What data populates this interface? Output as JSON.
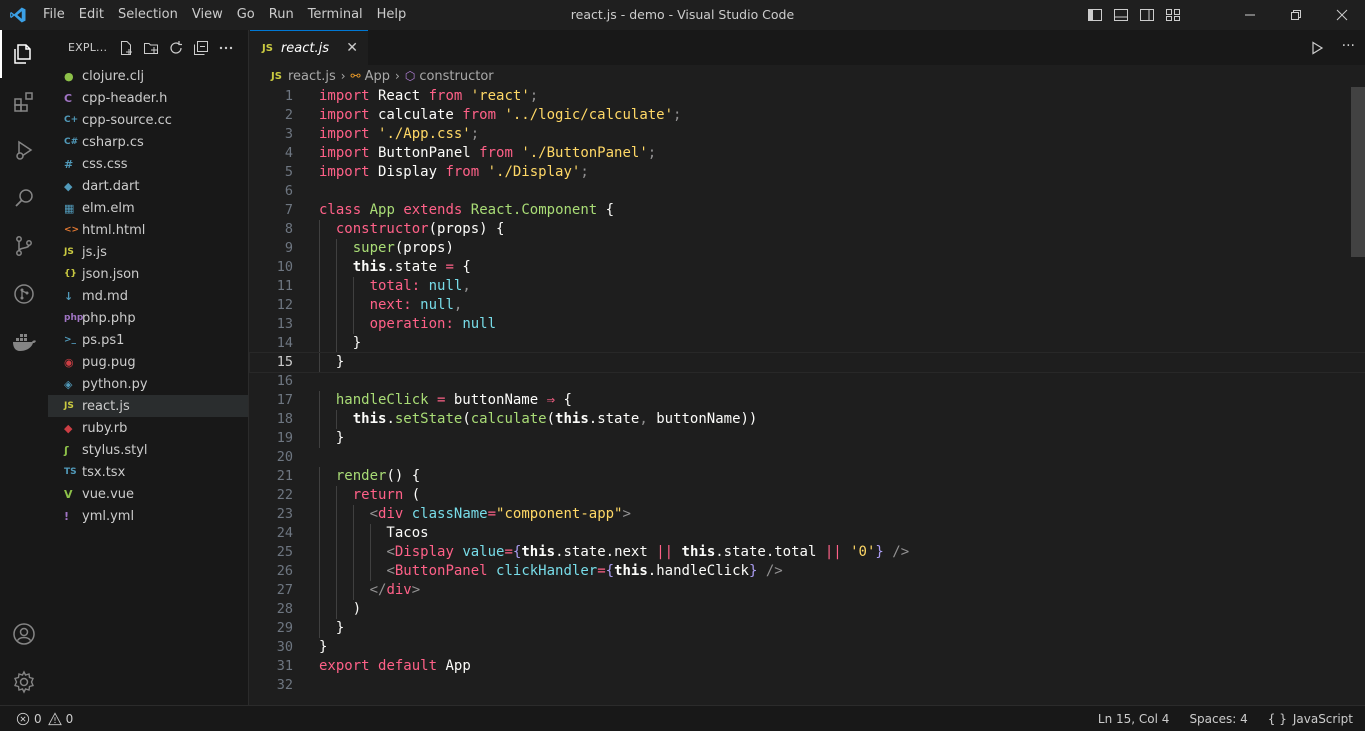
{
  "titlebar": {
    "title": "react.js - demo - Visual Studio Code",
    "menu": [
      "File",
      "Edit",
      "Selection",
      "View",
      "Go",
      "Run",
      "Terminal",
      "Help"
    ]
  },
  "sidebar": {
    "title": "EXPL...",
    "files": [
      {
        "name": "clojure.clj",
        "icon": "clojure-icon",
        "glyph": "●",
        "color": "#8dc149"
      },
      {
        "name": "cpp-header.h",
        "icon": "c-icon",
        "glyph": "C",
        "color": "#a074c4"
      },
      {
        "name": "cpp-source.cc",
        "icon": "cpp-icon",
        "glyph": "C+",
        "color": "#519aba"
      },
      {
        "name": "csharp.cs",
        "icon": "csharp-icon",
        "glyph": "C#",
        "color": "#519aba"
      },
      {
        "name": "css.css",
        "icon": "css-icon",
        "glyph": "#",
        "color": "#519aba"
      },
      {
        "name": "dart.dart",
        "icon": "dart-icon",
        "glyph": "◆",
        "color": "#519aba"
      },
      {
        "name": "elm.elm",
        "icon": "elm-icon",
        "glyph": "▦",
        "color": "#519aba"
      },
      {
        "name": "html.html",
        "icon": "html-icon",
        "glyph": "<>",
        "color": "#e37933"
      },
      {
        "name": "js.js",
        "icon": "js-icon",
        "glyph": "JS",
        "color": "#cbcb41"
      },
      {
        "name": "json.json",
        "icon": "json-icon",
        "glyph": "{}",
        "color": "#cbcb41"
      },
      {
        "name": "md.md",
        "icon": "markdown-icon",
        "glyph": "↓",
        "color": "#519aba"
      },
      {
        "name": "php.php",
        "icon": "php-icon",
        "glyph": "php",
        "color": "#a074c4"
      },
      {
        "name": "ps.ps1",
        "icon": "powershell-icon",
        "glyph": ">_",
        "color": "#519aba"
      },
      {
        "name": "pug.pug",
        "icon": "pug-icon",
        "glyph": "◉",
        "color": "#cc3e44"
      },
      {
        "name": "python.py",
        "icon": "python-icon",
        "glyph": "◈",
        "color": "#519aba"
      },
      {
        "name": "react.js",
        "icon": "js-icon",
        "glyph": "JS",
        "color": "#cbcb41",
        "selected": true
      },
      {
        "name": "ruby.rb",
        "icon": "ruby-icon",
        "glyph": "◆",
        "color": "#cc3e44"
      },
      {
        "name": "stylus.styl",
        "icon": "stylus-icon",
        "glyph": "ʃ",
        "color": "#8dc149"
      },
      {
        "name": "tsx.tsx",
        "icon": "typescript-icon",
        "glyph": "TS",
        "color": "#519aba"
      },
      {
        "name": "vue.vue",
        "icon": "vue-icon",
        "glyph": "V",
        "color": "#8dc149"
      },
      {
        "name": "yml.yml",
        "icon": "yaml-icon",
        "glyph": "!",
        "color": "#a074c4"
      }
    ]
  },
  "editor": {
    "tab_label": "react.js",
    "tab_badge": "JS",
    "breadcrumb": [
      "react.js",
      "App",
      "constructor"
    ],
    "current_line": 15,
    "lines": [
      [
        [
          "kw",
          "import"
        ],
        [
          "var",
          " React "
        ],
        [
          "kw",
          "from"
        ],
        [
          "punc",
          " "
        ],
        [
          "str",
          "'react'"
        ],
        [
          "punc",
          ";"
        ]
      ],
      [
        [
          "kw",
          "import"
        ],
        [
          "var",
          " calculate "
        ],
        [
          "kw",
          "from"
        ],
        [
          "punc",
          " "
        ],
        [
          "str",
          "'../logic/calculate'"
        ],
        [
          "punc",
          ";"
        ]
      ],
      [
        [
          "kw",
          "import"
        ],
        [
          "punc",
          " "
        ],
        [
          "str",
          "'./App.css'"
        ],
        [
          "punc",
          ";"
        ]
      ],
      [
        [
          "kw",
          "import"
        ],
        [
          "var",
          " ButtonPanel "
        ],
        [
          "kw",
          "from"
        ],
        [
          "punc",
          " "
        ],
        [
          "str",
          "'./ButtonPanel'"
        ],
        [
          "punc",
          ";"
        ]
      ],
      [
        [
          "kw",
          "import"
        ],
        [
          "var",
          " Display "
        ],
        [
          "kw",
          "from"
        ],
        [
          "punc",
          " "
        ],
        [
          "str",
          "'./Display'"
        ],
        [
          "punc",
          ";"
        ]
      ],
      [],
      [
        [
          "kw",
          "class"
        ],
        [
          "var",
          " "
        ],
        [
          "cls",
          "App"
        ],
        [
          "var",
          " "
        ],
        [
          "kw",
          "extends"
        ],
        [
          "var",
          " "
        ],
        [
          "cls",
          "React.Component"
        ],
        [
          "var",
          " {"
        ]
      ],
      [
        [
          "var",
          "  "
        ],
        [
          "kw",
          "constructor"
        ],
        [
          "var",
          "(props) {"
        ]
      ],
      [
        [
          "var",
          "    "
        ],
        [
          "fn",
          "super"
        ],
        [
          "var",
          "(props)"
        ]
      ],
      [
        [
          "var",
          "    "
        ],
        [
          "ths",
          "this"
        ],
        [
          "var",
          ".state "
        ],
        [
          "op",
          "="
        ],
        [
          "var",
          " {"
        ]
      ],
      [
        [
          "var",
          "      "
        ],
        [
          "prop",
          "total"
        ],
        [
          "op",
          ":"
        ],
        [
          "var",
          " "
        ],
        [
          "cst",
          "null"
        ],
        [
          "punc",
          ","
        ]
      ],
      [
        [
          "var",
          "      "
        ],
        [
          "prop",
          "next"
        ],
        [
          "op",
          ":"
        ],
        [
          "var",
          " "
        ],
        [
          "cst",
          "null"
        ],
        [
          "punc",
          ","
        ]
      ],
      [
        [
          "var",
          "      "
        ],
        [
          "prop",
          "operation"
        ],
        [
          "op",
          ":"
        ],
        [
          "var",
          " "
        ],
        [
          "cst",
          "null"
        ]
      ],
      [
        [
          "var",
          "    }"
        ]
      ],
      [
        [
          "var",
          "  }"
        ]
      ],
      [],
      [
        [
          "var",
          "  "
        ],
        [
          "fn",
          "handleClick"
        ],
        [
          "var",
          " "
        ],
        [
          "op",
          "="
        ],
        [
          "var",
          " buttonName "
        ],
        [
          "op",
          "⇒"
        ],
        [
          "var",
          " {"
        ]
      ],
      [
        [
          "var",
          "    "
        ],
        [
          "ths",
          "this"
        ],
        [
          "var",
          "."
        ],
        [
          "fn",
          "setState"
        ],
        [
          "var",
          "("
        ],
        [
          "fn",
          "calculate"
        ],
        [
          "var",
          "("
        ],
        [
          "ths",
          "this"
        ],
        [
          "var",
          ".state"
        ],
        [
          "punc",
          ","
        ],
        [
          "var",
          " buttonName))"
        ]
      ],
      [
        [
          "var",
          "  }"
        ]
      ],
      [],
      [
        [
          "var",
          "  "
        ],
        [
          "fn",
          "render"
        ],
        [
          "var",
          "() {"
        ]
      ],
      [
        [
          "var",
          "    "
        ],
        [
          "kw",
          "return"
        ],
        [
          "var",
          " ("
        ]
      ],
      [
        [
          "var",
          "      "
        ],
        [
          "punc",
          "<"
        ],
        [
          "tag",
          "div"
        ],
        [
          "var",
          " "
        ],
        [
          "attr",
          "className"
        ],
        [
          "op",
          "="
        ],
        [
          "str",
          "\"component-app\""
        ],
        [
          "punc",
          ">"
        ]
      ],
      [
        [
          "var",
          "        Tacos"
        ]
      ],
      [
        [
          "var",
          "        "
        ],
        [
          "punc",
          "<"
        ],
        [
          "tag",
          "Display"
        ],
        [
          "var",
          " "
        ],
        [
          "attr",
          "value"
        ],
        [
          "op",
          "="
        ],
        [
          "mb",
          "{"
        ],
        [
          "ths",
          "this"
        ],
        [
          "var",
          ".state.next "
        ],
        [
          "op",
          "||"
        ],
        [
          "var",
          " "
        ],
        [
          "ths",
          "this"
        ],
        [
          "var",
          ".state.total "
        ],
        [
          "op",
          "||"
        ],
        [
          "var",
          " "
        ],
        [
          "str",
          "'0'"
        ],
        [
          "mb",
          "}"
        ],
        [
          "var",
          " "
        ],
        [
          "punc",
          "/>"
        ]
      ],
      [
        [
          "var",
          "        "
        ],
        [
          "punc",
          "<"
        ],
        [
          "tag",
          "ButtonPanel"
        ],
        [
          "var",
          " "
        ],
        [
          "attr",
          "clickHandler"
        ],
        [
          "op",
          "="
        ],
        [
          "mb",
          "{"
        ],
        [
          "ths",
          "this"
        ],
        [
          "var",
          ".handleClick"
        ],
        [
          "mb",
          "}"
        ],
        [
          "var",
          " "
        ],
        [
          "punc",
          "/>"
        ]
      ],
      [
        [
          "var",
          "      "
        ],
        [
          "punc",
          "</"
        ],
        [
          "tag",
          "div"
        ],
        [
          "punc",
          ">"
        ]
      ],
      [
        [
          "var",
          "    )"
        ]
      ],
      [
        [
          "var",
          "  }"
        ]
      ],
      [
        [
          "var",
          "}"
        ]
      ],
      [
        [
          "kw",
          "export"
        ],
        [
          "var",
          " "
        ],
        [
          "kw",
          "default"
        ],
        [
          "var",
          " App"
        ]
      ],
      []
    ]
  },
  "statusbar": {
    "errors": "0",
    "warnings": "0",
    "position": "Ln 15, Col 4",
    "spaces": "Spaces: 4",
    "language": "JavaScript"
  },
  "colors": {
    "accent": "#0078d4",
    "keyword": "#ff6188",
    "string": "#ffd866",
    "function": "#a9dc76",
    "constant": "#78dce8"
  }
}
